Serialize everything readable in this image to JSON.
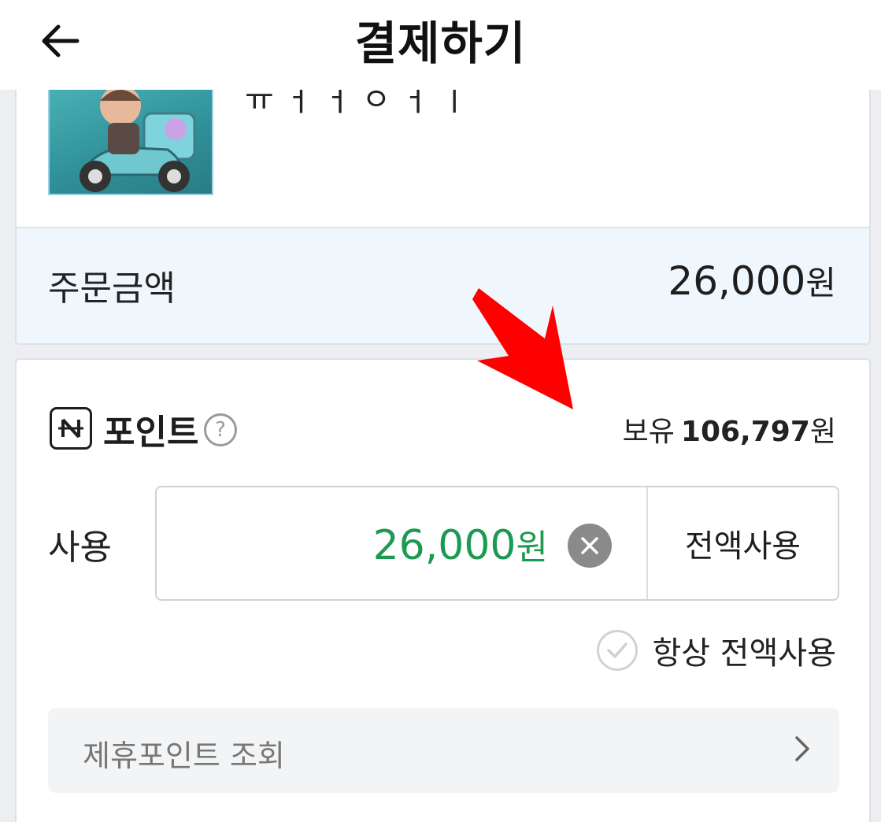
{
  "header": {
    "title": "결제하기"
  },
  "product": {
    "name": "ㅠ ㅓ ㅓ ㅇ ㅓ ㅣ"
  },
  "order": {
    "label": "주문금액",
    "amount": "26,000",
    "currency": "원"
  },
  "points": {
    "badge": "N",
    "title": "포인트",
    "help_glyph": "?",
    "balance_label": "보유",
    "balance_value": "106,797",
    "balance_currency": "원",
    "use_label": "사용",
    "use_value": "26,000",
    "use_currency": "원",
    "full_use_label": "전액사용",
    "always_full_use_label": "항상 전액사용",
    "partner_points_label": "제휴포인트 조회"
  },
  "colors": {
    "use_value": "#1d9a52",
    "order_row_bg": "#eff7fc",
    "annotation_arrow": "#ff0000"
  },
  "icons": [
    "back-arrow-icon",
    "question-icon",
    "close-icon",
    "check-icon",
    "chevron-right-icon",
    "annotation-arrow-icon"
  ]
}
